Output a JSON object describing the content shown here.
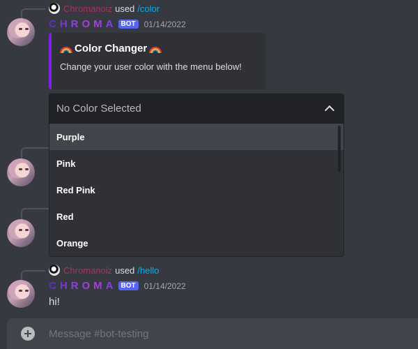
{
  "messages": [
    {
      "reply": {
        "name": "Chromanoiz",
        "used": "used",
        "command": "/color"
      },
      "author": {
        "name": "CHROMA",
        "tag": "BOT",
        "time": "01/14/2022"
      },
      "embed": {
        "title": "Color Changer",
        "description": "Change your user color with the menu below!"
      }
    },
    {
      "reply": {
        "name": "Chromanoiz",
        "used": "used",
        "command": "/hello"
      },
      "author": {
        "name": "CHROMA",
        "tag": "BOT",
        "time": "01/14/2022"
      },
      "content": "hi!"
    }
  ],
  "select": {
    "placeholder": "No Color Selected",
    "options": [
      "Purple",
      "Pink",
      "Red Pink",
      "Red",
      "Orange"
    ],
    "hovered_index": 0
  },
  "composer": {
    "placeholder": "Message #bot-testing"
  },
  "colors": {
    "accent": "#5865f2",
    "embed_border": "#7d1fe6",
    "reply_name": "#a8325e",
    "command_link": "#00aff4"
  }
}
